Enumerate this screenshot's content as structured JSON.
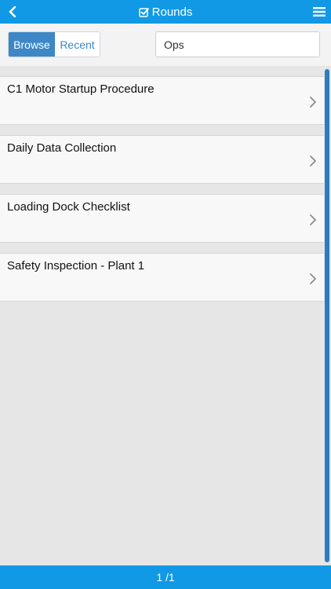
{
  "header": {
    "title": "Rounds",
    "back_icon": "chevron-left-icon",
    "title_icon": "checkbox-icon",
    "menu_icon": "hamburger-menu-icon"
  },
  "toolbar": {
    "tabs": [
      {
        "label": "Browse",
        "active": true
      },
      {
        "label": "Recent",
        "active": false
      }
    ],
    "search": {
      "value": "Ops",
      "placeholder": ""
    }
  },
  "list": {
    "items": [
      {
        "label": "C1 Motor Startup Procedure"
      },
      {
        "label": "Daily Data Collection"
      },
      {
        "label": "Loading Dock Checklist"
      },
      {
        "label": "Safety Inspection - Plant 1"
      }
    ]
  },
  "footer": {
    "pagination": "1 /1"
  },
  "colors": {
    "brand": "#1199e6",
    "accent": "#3d87c7"
  }
}
